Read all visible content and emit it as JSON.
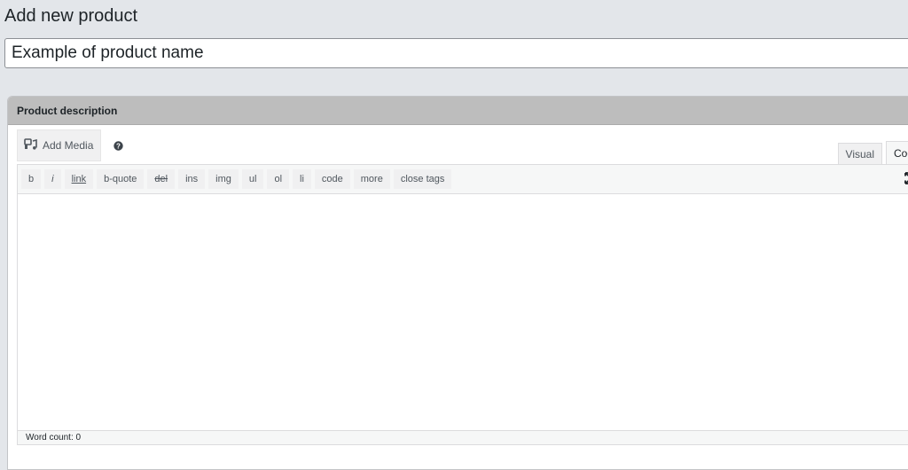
{
  "page": {
    "title": "Add new product"
  },
  "product": {
    "name_value": "Example of product name"
  },
  "description_box": {
    "title": "Product description",
    "add_media_label": "Add Media",
    "tabs": [
      {
        "label": "Visual",
        "active": false
      },
      {
        "label": "Code",
        "active": true
      }
    ],
    "quicktags": [
      "b",
      "i",
      "link",
      "b-quote",
      "del",
      "ins",
      "img",
      "ul",
      "ol",
      "li",
      "code",
      "more",
      "close tags"
    ],
    "editor_content": "",
    "word_count": "Word count: 0"
  },
  "icons": {
    "add_media": "media-icon",
    "help": "help-icon",
    "fullscreen": "fullscreen-icon"
  }
}
